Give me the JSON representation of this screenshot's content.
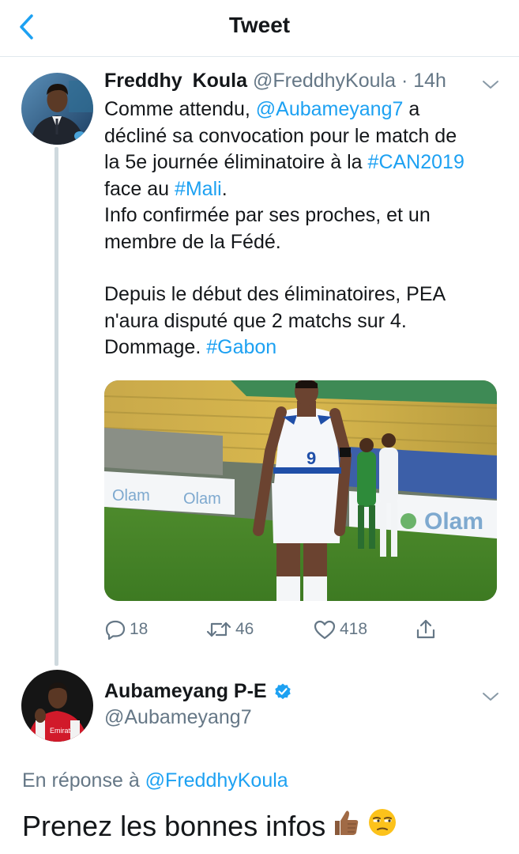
{
  "header": {
    "title": "Tweet",
    "back_icon": "chevron-left-icon",
    "accent_color": "#1da1f2"
  },
  "tweet1": {
    "author_name": "Freddhy  Koula",
    "handle": "@FreddhyKoula",
    "separator": "·",
    "time": "14h",
    "body": {
      "l1_a": "Comme attendu, ",
      "l1_mention": "@Aubameyang7",
      "l1_b": " a",
      "l2": "décliné sa convocation pour le match de",
      "l3_a": "la 5e journée éliminatoire à la ",
      "l3_hashtag": "#CAN2019",
      "l4_a": "face au ",
      "l4_hashtag": "#Mali",
      "l4_b": ".",
      "l5": "Info confirmée par ses proches, et un",
      "l6": "membre de la Fédé.",
      "l7": "Depuis le début des éliminatoires, PEA",
      "l8": "n'aura disputé que 2 matchs sur 4.",
      "l9_a": "Dommage. ",
      "l9_hashtag": "#Gabon"
    },
    "media": {
      "ad_board_text": "Olam",
      "jersey_number": "9"
    },
    "actions": {
      "replies": "18",
      "retweets": "46",
      "likes": "418"
    }
  },
  "tweet2": {
    "author_name": "Aubameyang P-E",
    "verified": true,
    "handle": "@Aubameyang7",
    "reply_prefix": "En réponse à ",
    "reply_to": "@FreddhyKoula",
    "text": "Prenez les bonnes infos",
    "emojis": [
      "thumbs-up-medium-dark-skin",
      "unamused-face"
    ],
    "avatar_shirt_text": "Emirat"
  }
}
